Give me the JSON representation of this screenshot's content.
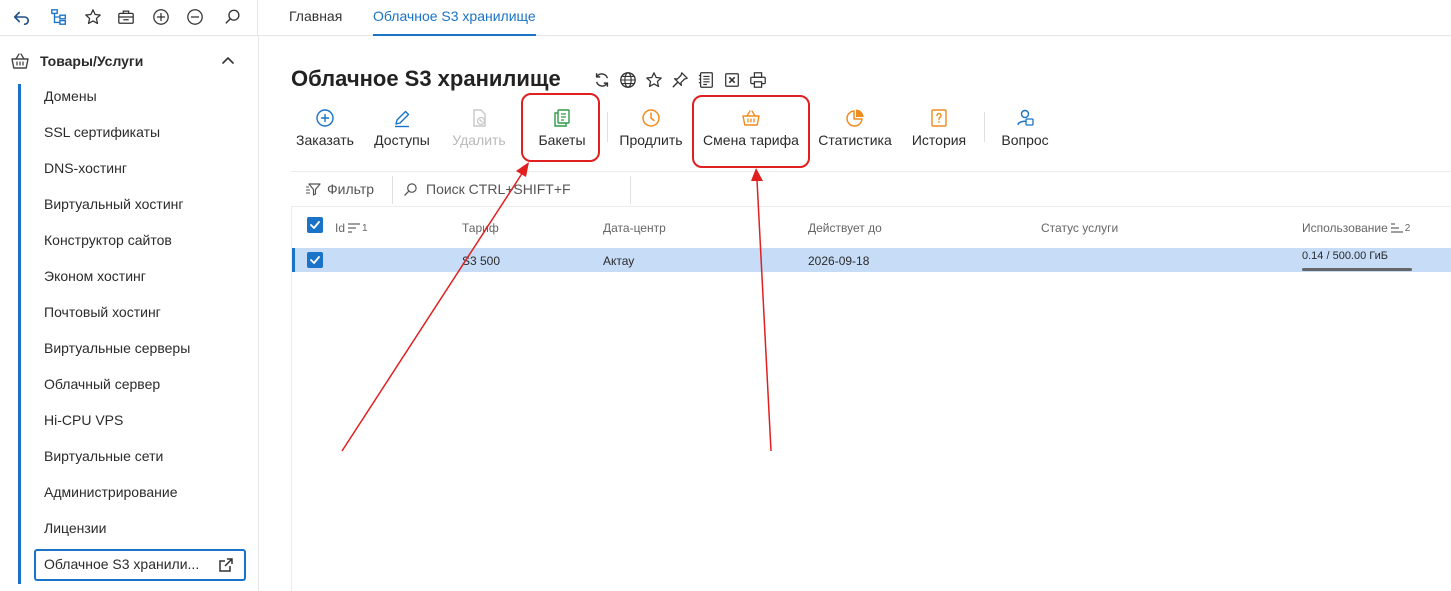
{
  "topbar": {
    "icons": [
      "back-arrow-icon",
      "tree-structure-icon",
      "star-icon",
      "briefcase-icon",
      "plus-circle-icon",
      "minus-circle-icon",
      "search-icon"
    ],
    "tabs": [
      {
        "label": "Главная",
        "active": false
      },
      {
        "label": "Облачное S3 хранилище",
        "active": true
      }
    ]
  },
  "sidebar": {
    "section_title": "Товары/Услуги",
    "items": [
      {
        "label": "Домены"
      },
      {
        "label": "SSL сертификаты"
      },
      {
        "label": "DNS-хостинг"
      },
      {
        "label": "Виртуальный хостинг"
      },
      {
        "label": "Конструктор сайтов"
      },
      {
        "label": "Эконом хостинг"
      },
      {
        "label": "Почтовый хостинг"
      },
      {
        "label": "Виртуальные серверы"
      },
      {
        "label": "Облачный сервер"
      },
      {
        "label": "Hi-CPU VPS"
      },
      {
        "label": "Виртуальные сети"
      },
      {
        "label": "Администрирование"
      },
      {
        "label": "Лицензии"
      }
    ],
    "active_item": "Облачное S3 хранили..."
  },
  "page": {
    "title": "Облачное S3 хранилище",
    "title_icons": [
      "refresh-icon",
      "globe-icon",
      "star-icon",
      "pin-icon",
      "document-list-icon",
      "excel-export-icon",
      "print-icon"
    ]
  },
  "toolbar": {
    "order": "Заказать",
    "access": "Доступы",
    "delete": "Удалить",
    "buckets": "Бакеты",
    "renew": "Продлить",
    "change_tariff": "Смена тарифа",
    "statistics": "Статистика",
    "history": "История",
    "question": "Вопрос"
  },
  "filterbar": {
    "filter_label": "Фильтр",
    "search_placeholder": "Поиск CTRL+SHIFT+F"
  },
  "table": {
    "headers": {
      "id": "Id",
      "id_sort": "1",
      "tariff": "Тариф",
      "datacenter": "Дата-центр",
      "valid_until": "Действует до",
      "status": "Статус услуги",
      "usage": "Использование",
      "usage_sort": "2"
    },
    "rows": [
      {
        "selected": true,
        "id": "",
        "tariff": "S3 500",
        "datacenter": "Актау",
        "valid_until": "2026-09-18",
        "status": "",
        "usage": "0.14 / 500.00 ГиБ",
        "usage_fraction": 0.00028
      }
    ]
  },
  "colors": {
    "accent": "#1a73c7",
    "selected_row": "#c6dcf7",
    "annotation": "#e02020",
    "icon_orange": "#f08c1e",
    "icon_green": "#2e9a46"
  }
}
